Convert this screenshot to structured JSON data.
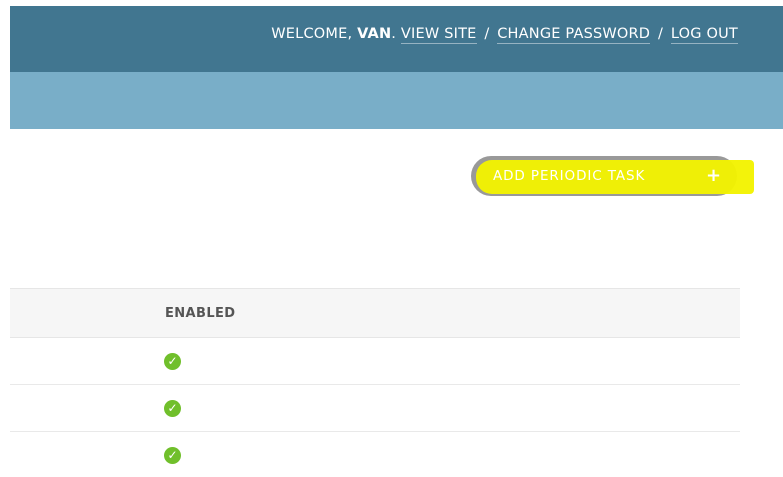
{
  "header": {
    "welcome_prefix": "WELCOME,",
    "user_name": "VAN",
    "name_suffix": ".",
    "links": [
      "VIEW SITE",
      "CHANGE PASSWORD",
      "LOG OUT"
    ],
    "separator": "/"
  },
  "object_tools": {
    "add_label": "ADD PERIODIC TASK",
    "add_icon": "+"
  },
  "table": {
    "header": "ENABLED",
    "rows": [
      {
        "enabled": true,
        "icon": "check-circle-icon"
      },
      {
        "enabled": true,
        "icon": "check-circle-icon"
      },
      {
        "enabled": true,
        "icon": "check-circle-icon"
      }
    ]
  },
  "colors": {
    "header_bg": "#417690",
    "breadcrumb_bg": "#79aec8",
    "button_bg": "#999999",
    "highlight": "#f2f200",
    "check_green": "#70bf2b"
  }
}
